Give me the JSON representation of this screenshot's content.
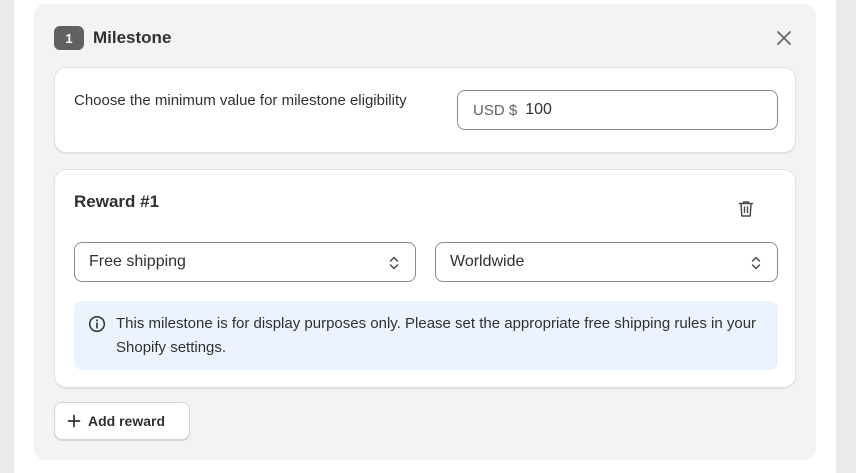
{
  "milestone": {
    "number": "1",
    "title": "Milestone"
  },
  "minimum": {
    "label": "Choose the minimum value for milestone eligibility",
    "currency_prefix": "USD $",
    "value": "100"
  },
  "reward": {
    "title": "Reward #1",
    "type_select": "Free shipping",
    "region_select": "Worldwide",
    "info_banner": "This milestone is for display purposes only. Please set the appropriate free shipping rules in your Shopify settings."
  },
  "actions": {
    "add_reward_label": "Add reward"
  },
  "icons": {
    "close": "close-icon",
    "trash": "trash-icon",
    "chevron": "select-chevron-icon",
    "info": "info-icon",
    "plus": "plus-icon"
  },
  "colors": {
    "banner_bg": "#eaf4ff",
    "badge_bg": "#616161",
    "panel_bg": "#f3f3f3"
  }
}
